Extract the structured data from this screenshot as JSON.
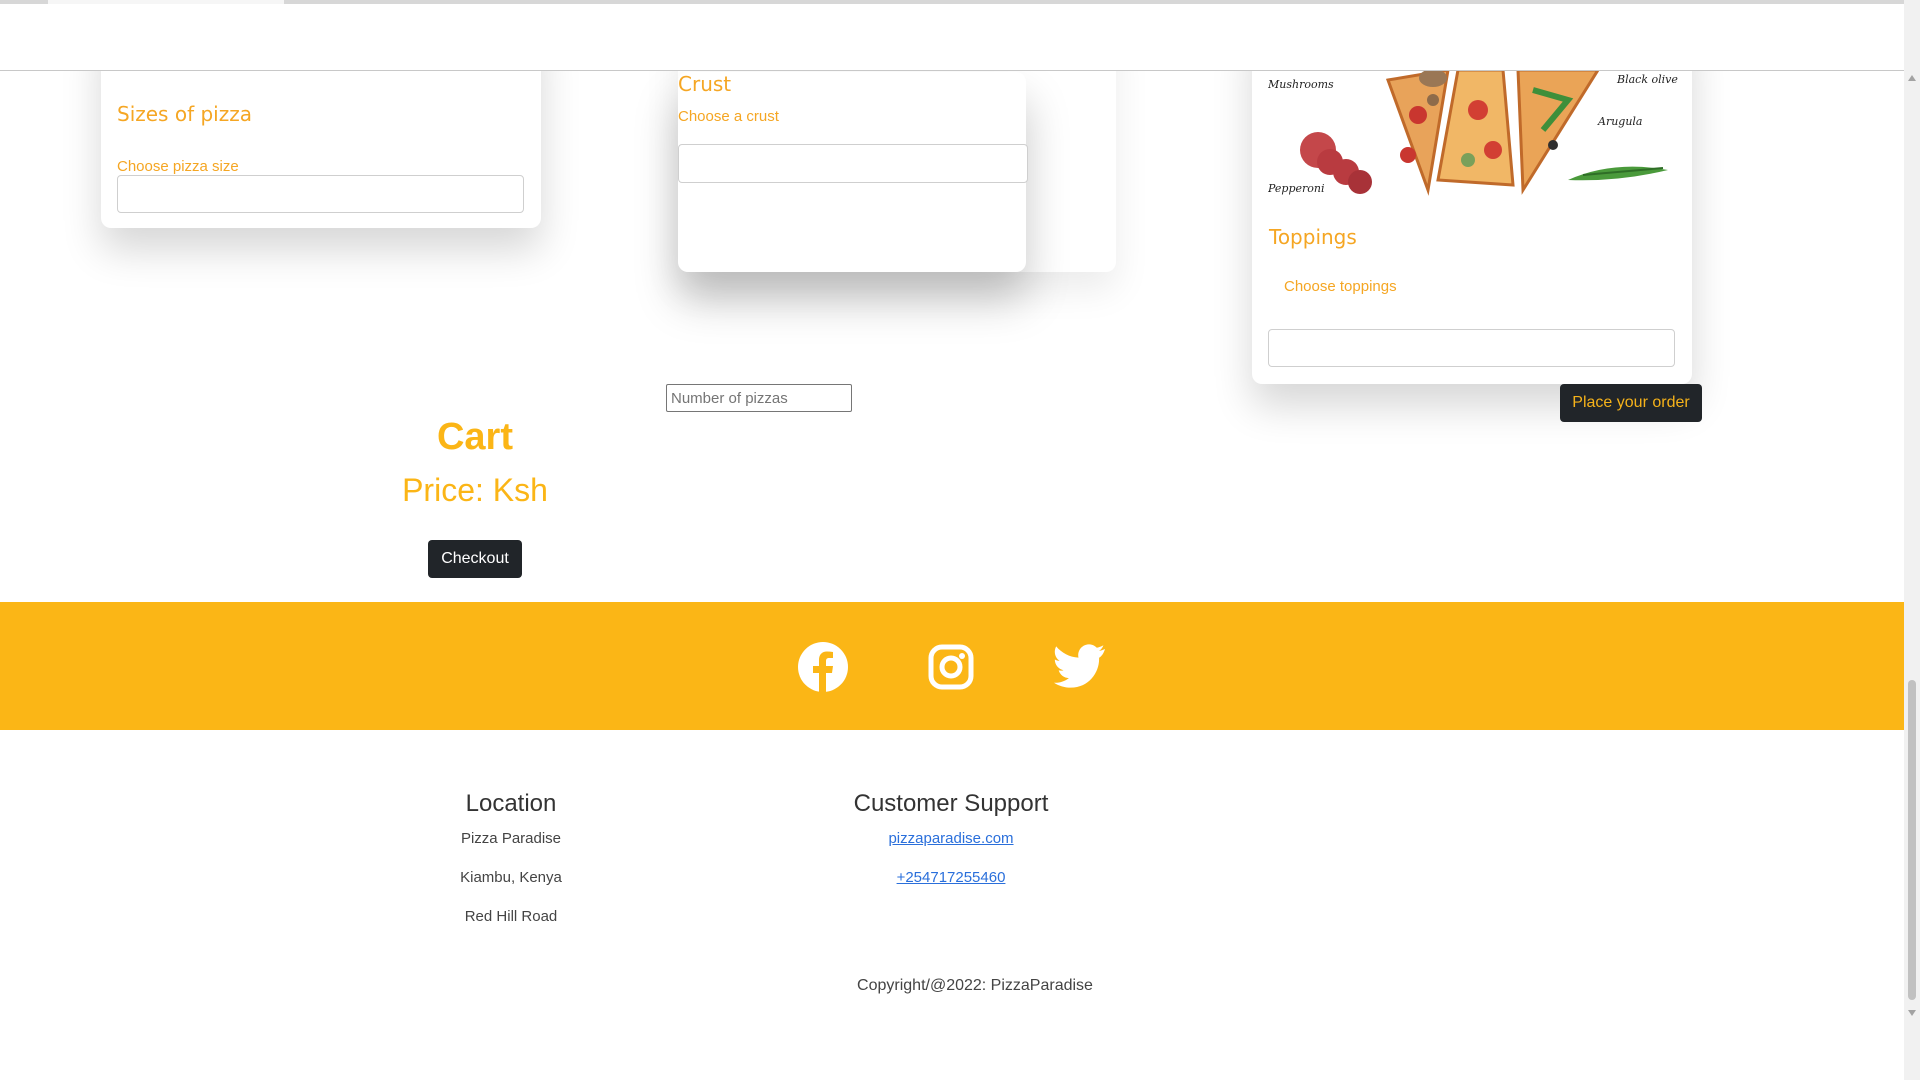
{
  "colors": {
    "accent": "#fbb616",
    "card_text": "#f5a623",
    "button_dark": "#212529",
    "link": "#2a6fdb"
  },
  "size_card": {
    "title": "Sizes of pizza",
    "subtitle": "Choose pizza size",
    "select_value": ""
  },
  "crust_card": {
    "title": "Crust",
    "subtitle": "Choose a crust",
    "select_value": ""
  },
  "toppings_card": {
    "image_labels": [
      "Mushrooms",
      "Black olives",
      "Arugula",
      "Pepperoni"
    ],
    "title": "Toppings",
    "subtitle": "Choose toppings",
    "select_value": ""
  },
  "order": {
    "quantity_placeholder": "Number of pizzas",
    "place_order_label": "Place your order"
  },
  "cart": {
    "title": "Cart",
    "price_label": "Price: Ksh",
    "checkout_label": "Checkout"
  },
  "social": {
    "icons": [
      "facebook-icon",
      "instagram-icon",
      "twitter-icon"
    ]
  },
  "footer": {
    "location": {
      "heading": "Location",
      "lines": [
        "Pizza Paradise",
        "Kiambu, Kenya",
        "Red Hill Road"
      ]
    },
    "support": {
      "heading": "Customer Support",
      "website": "pizzaparadise.com",
      "phone": "+254717255460"
    },
    "copyright": "Copyright/@2022: PizzaParadise"
  }
}
